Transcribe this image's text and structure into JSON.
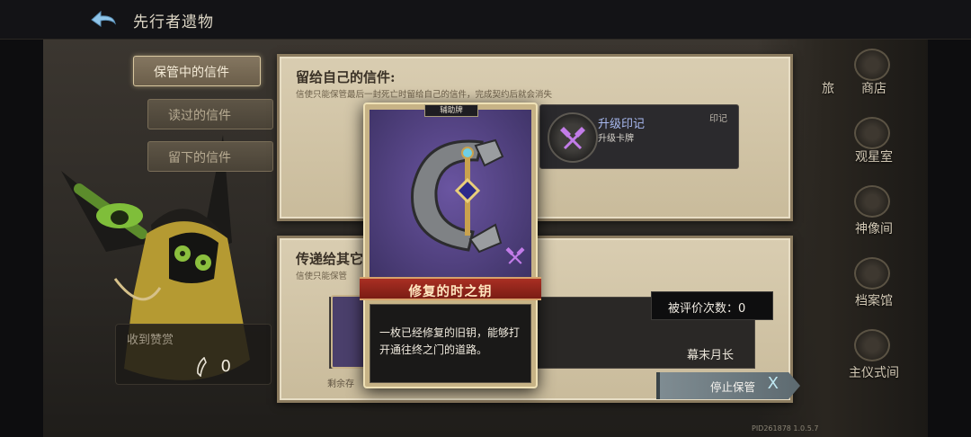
{
  "header": {
    "title": "先行者遗物"
  },
  "tabs": [
    {
      "label": "保管中的信件",
      "active": true
    },
    {
      "label": "读过的信件",
      "active": false
    },
    {
      "label": "留下的信件",
      "active": false
    }
  ],
  "reward": {
    "label": "收到赞赏",
    "count": "0"
  },
  "self_letter": {
    "title": "留给自己的信件:",
    "description": "信使只能保管最后一封死亡时留给自己的信件，完成契约后就会消失"
  },
  "stamp": {
    "name": "升级印记",
    "sub": "升级卡牌",
    "tag": "印记"
  },
  "others_letter": {
    "title": "传递给其它",
    "description": "信使只能保管"
  },
  "letter": {
    "snippet": "。",
    "author": "幕末月长",
    "rating_label": "被评价次数：0",
    "remaining": "剩余存"
  },
  "stop_button": {
    "label": "停止保管",
    "close_glyph": "X"
  },
  "side_nav": [
    {
      "label": "旅"
    },
    {
      "label": "商店"
    },
    {
      "label": "观星室"
    },
    {
      "label": "神像间"
    },
    {
      "label": "档案馆"
    },
    {
      "label": "主仪式间"
    }
  ],
  "card_popup": {
    "type_label": "辅助牌",
    "name": "修复的时之钥",
    "description": "一枚已经修复的旧钥，能够打开通往终之门的道路。"
  },
  "version": "PID261878 1.0.5.7",
  "colors": {
    "accent_purple": "#51417f",
    "name_red": "#a92f23",
    "panel_parchment": "#d9cdb1"
  }
}
